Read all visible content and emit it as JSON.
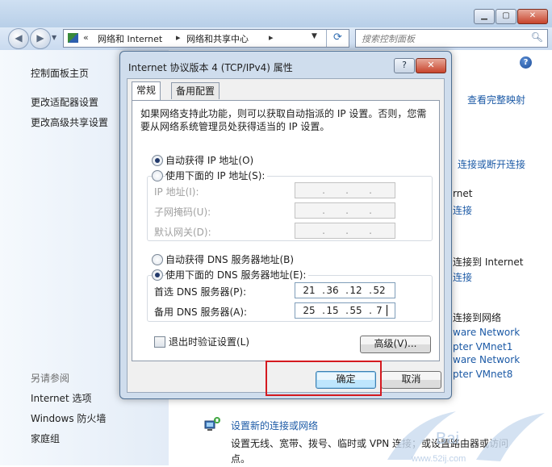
{
  "window": {
    "address": {
      "overflow": "«",
      "crumbs": [
        "网络和 Internet",
        "网络和共享中心"
      ],
      "separator": "▸"
    },
    "search_placeholder": "搜索控制面板"
  },
  "left_pane": {
    "links": [
      "控制面板主页",
      "更改适配器设置",
      "更改高级共享设置"
    ],
    "see_also_header": "另请参阅",
    "see_also": [
      "Internet 选项",
      "Windows 防火墙",
      "家庭组"
    ]
  },
  "right_content": {
    "view_full_map": "查看完整映射",
    "connect_disconnect": "连接或断开连接",
    "fragments": [
      "rnet",
      "连接",
      "连接到 Internet",
      "连接",
      "连接到网络",
      "ware Network",
      "pter VMnet1",
      "ware Network",
      "pter VMnet8"
    ],
    "setup_link": "设置新的连接或网络",
    "setup_desc": "设置无线、宽带、拨号、临时或 VPN 连接；或设置路由器或访问点。"
  },
  "dialog": {
    "title": "Internet 协议版本 4 (TCP/IPv4) 属性",
    "help_btn": "?",
    "close_btn": "✕",
    "tabs": [
      "常规",
      "备用配置"
    ],
    "description": "如果网络支持此功能，则可以获取自动指派的 IP 设置。否则，您需要从网络系统管理员处获得适当的 IP 设置。",
    "ip_auto": "自动获得 IP 地址(O)",
    "ip_manual": "使用下面的 IP 地址(S):",
    "ip_fields": [
      "IP 地址(I):",
      "子网掩码(U):",
      "默认网关(D):"
    ],
    "dns_auto": "自动获得 DNS 服务器地址(B)",
    "dns_manual": "使用下面的 DNS 服务器地址(E):",
    "dns_preferred_label": "首选 DNS 服务器(P):",
    "dns_preferred": [
      "21",
      "36",
      "12",
      "52"
    ],
    "dns_alternate_label": "备用 DNS 服务器(A):",
    "dns_alternate": [
      "25",
      "15",
      "55",
      "7"
    ],
    "validate_on_exit": "退出时验证设置(L)",
    "advanced": "高级(V)...",
    "ok": "确定",
    "cancel": "取消"
  }
}
